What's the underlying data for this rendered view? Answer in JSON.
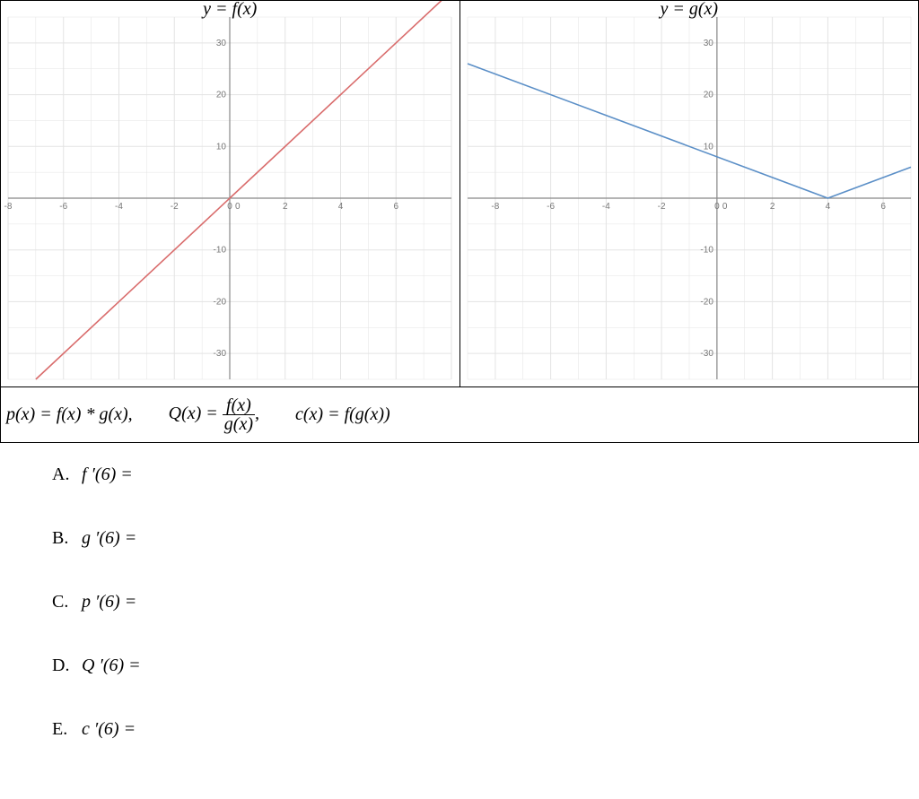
{
  "chart_data": [
    {
      "type": "line",
      "title": "y = f(x)",
      "xlabel": "",
      "ylabel": "",
      "xlim": [
        -8,
        8
      ],
      "ylim": [
        -35,
        35
      ],
      "xticks": [
        -8,
        -6,
        -4,
        -2,
        0,
        2,
        4,
        6
      ],
      "yticks": [
        -30,
        -20,
        -10,
        10,
        20,
        30
      ],
      "series": [
        {
          "name": "f",
          "color": "#d96c6c",
          "x": [
            -7,
            8
          ],
          "y": [
            -35,
            40
          ]
        }
      ],
      "note": "Linear function with slope 5 through origin; f(x)=5x"
    },
    {
      "type": "line",
      "title": "y = g(x)",
      "xlabel": "",
      "ylabel": "",
      "xlim": [
        -9,
        7
      ],
      "ylim": [
        -35,
        35
      ],
      "xticks": [
        -8,
        -6,
        -4,
        -2,
        0,
        2,
        4,
        6
      ],
      "yticks": [
        -30,
        -20,
        -10,
        10,
        20,
        30
      ],
      "series": [
        {
          "name": "g",
          "color": "#5b8fc7",
          "x": [
            -9,
            4,
            7
          ],
          "y": [
            26,
            0,
            6
          ]
        }
      ],
      "note": "Piecewise linear; slope -2 for x<4 and slope 2 for x>4, vertex at (4,0)"
    }
  ],
  "definitions": {
    "p": "p(x) = f(x) * g(x),",
    "Q_lhs": "Q(x) =",
    "Q_num": "f(x)",
    "Q_den": "g(x)",
    "Q_tail": ",",
    "c": "c(x) = f(g(x))"
  },
  "questions": {
    "A": "f ′(6) =",
    "B": "g ′(6) =",
    "C": "p ′(6) =",
    "D": "Q ′(6) =",
    "E": "c ′(6) ="
  },
  "fig_titles": {
    "left": "y = f(x)",
    "right": "y = g(x)"
  }
}
